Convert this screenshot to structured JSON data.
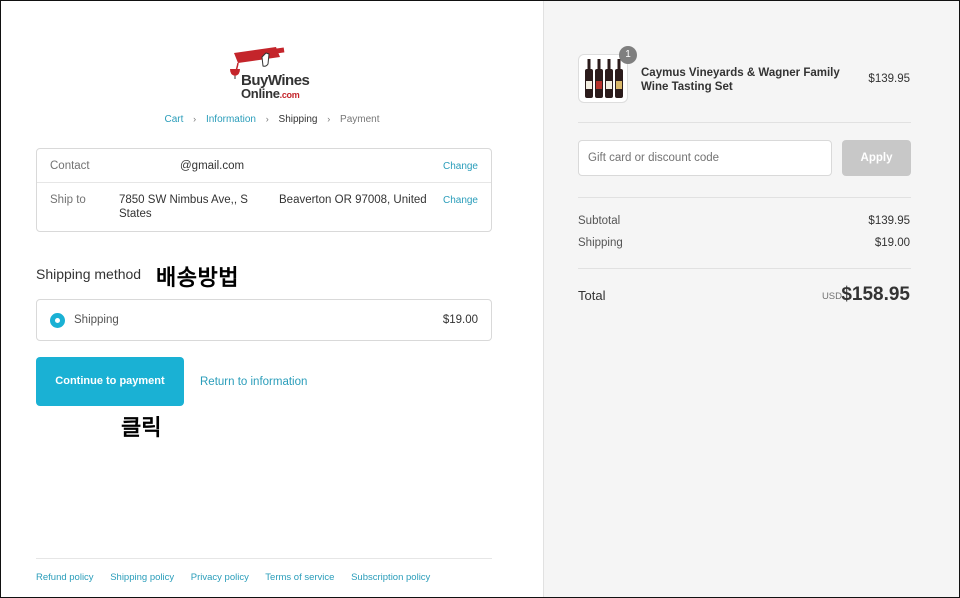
{
  "logo": {
    "line1": "BuyWines",
    "line2_main": "Online",
    "line2_suffix": ".com"
  },
  "breadcrumb": {
    "items": [
      "Cart",
      "Information",
      "Shipping",
      "Payment"
    ],
    "separator": "›"
  },
  "review": {
    "contact_label": "Contact",
    "contact_value": "@gmail.com",
    "contact_change": "Change",
    "shipto_label": "Ship to",
    "shipto_line1": "7850 SW Nimbus Ave,, S States",
    "shipto_line2": "Beaverton OR 97008, United",
    "shipto_change": "Change"
  },
  "shipping_method": {
    "heading": "Shipping method",
    "annotation": "배송방법",
    "option_label": "Shipping",
    "option_price": "$19.00"
  },
  "actions": {
    "continue_label": "Continue to payment",
    "return_label": "Return to information",
    "annotation": "클릭"
  },
  "footer": {
    "links": [
      "Refund policy",
      "Shipping policy",
      "Privacy policy",
      "Terms of service",
      "Subscription policy"
    ]
  },
  "order": {
    "quantity_badge": "1",
    "product_name": "Caymus Vineyards & Wagner Family Wine Tasting Set",
    "product_price": "$139.95",
    "discount_placeholder": "Gift card or discount code",
    "apply_label": "Apply",
    "subtotal_label": "Subtotal",
    "subtotal_value": "$139.95",
    "shipping_label": "Shipping",
    "shipping_value": "$19.00",
    "total_label": "Total",
    "total_currency": "USD",
    "total_value": "$158.95"
  },
  "colors": {
    "accent": "#1ab1d4",
    "link": "#2a9dba",
    "brand_red": "#c4252b"
  }
}
